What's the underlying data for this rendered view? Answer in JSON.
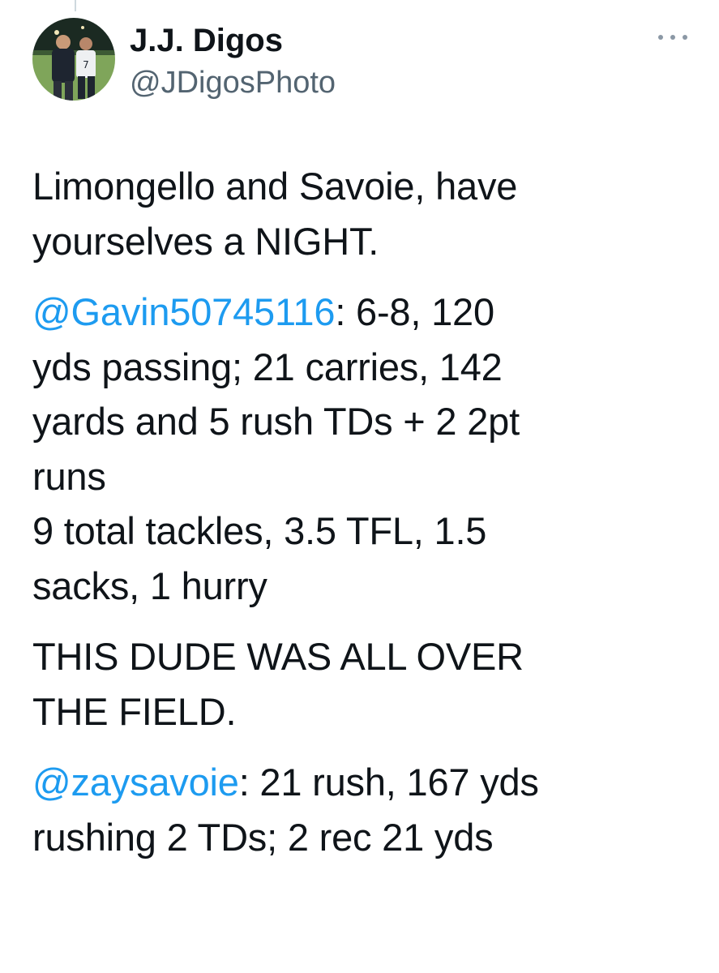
{
  "author": {
    "display_name": "J.J. Digos",
    "handle": "@JDigosPhoto"
  },
  "tweet": {
    "p1": {
      "l1": "Limongello and Savoie, have",
      "l2": "yourselves a NIGHT."
    },
    "p2": {
      "mention": "@Gavin50745116",
      "l1_rest": ": 6-8, 120",
      "l2": "yds passing; 21 carries, 142",
      "l3": "yards and 5 rush TDs + 2 2pt",
      "l4": "runs",
      "l5": "9 total tackles, 3.5 TFL, 1.5",
      "l6": "sacks, 1 hurry"
    },
    "p3": {
      "l1": "THIS DUDE WAS ALL OVER",
      "l2": "THE FIELD."
    },
    "p4": {
      "mention": "@zaysavoie",
      "l1_rest": ": 21 rush, 167 yds",
      "l2": "rushing 2 TDs; 2 rec 21 yds"
    }
  },
  "icons": {
    "more": "more-horizontal-icon",
    "avatar": "profile-photo"
  },
  "colors": {
    "text": "#0f1419",
    "secondary": "#536471",
    "link": "#1d9bf0"
  }
}
